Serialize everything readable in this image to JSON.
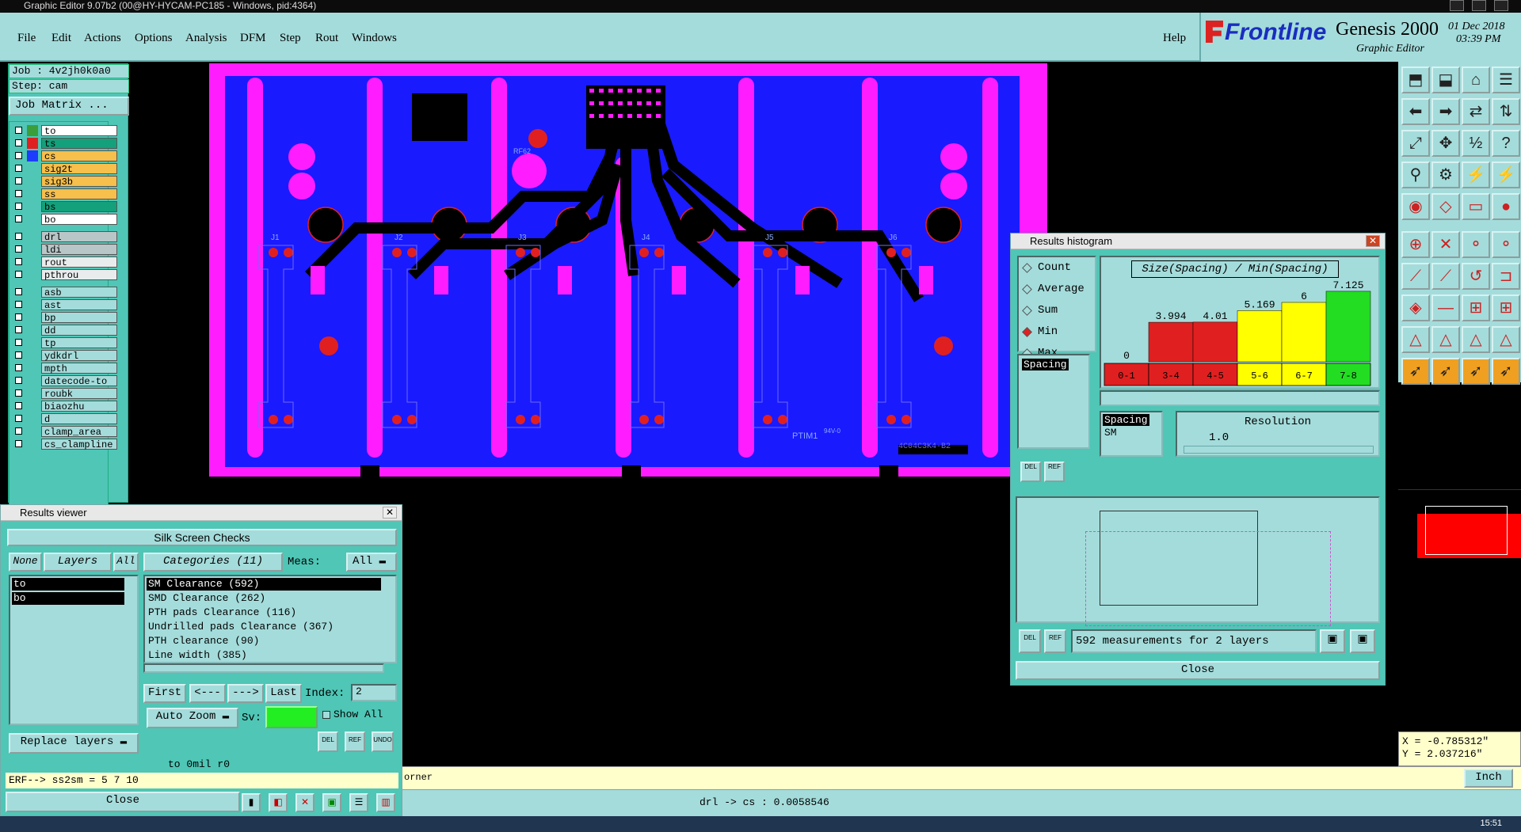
{
  "window": {
    "title": "Graphic Editor 9.07b2 (00@HY-HYCAM-PC185 - Windows, pid:4364)"
  },
  "menu": {
    "items": [
      "File",
      "Edit",
      "Actions",
      "Options",
      "Analysis",
      "DFM",
      "Step",
      "Rout",
      "Windows"
    ],
    "help": "Help"
  },
  "brand": {
    "logo": "Frontline",
    "product": "Genesis 2000",
    "subtitle": "Graphic Editor",
    "date": "01 Dec 2018",
    "time": "03:39 PM"
  },
  "job": {
    "job_label": "Job : 4v2jh0k0a0",
    "step_label": "Step: cam",
    "matrix_button": "Job Matrix ..."
  },
  "layers": [
    {
      "name": "to",
      "color": "#3a9f3a",
      "fill": "#ffffff"
    },
    {
      "name": "ts",
      "color": "#e02020",
      "fill": "#14a07a"
    },
    {
      "name": "cs",
      "color": "#1e3cff",
      "fill": "#f7bf4b"
    },
    {
      "name": "sig2t",
      "color": "",
      "fill": "#f7bf4b"
    },
    {
      "name": "sig3b",
      "color": "",
      "fill": "#f7bf4b"
    },
    {
      "name": "ss",
      "color": "",
      "fill": "#f7bf4b"
    },
    {
      "name": "bs",
      "color": "",
      "fill": "#14a07a"
    },
    {
      "name": "bo",
      "color": "",
      "fill": "#ffffff"
    },
    {
      "name": "drl",
      "color": "",
      "fill": "#b9c6c8"
    },
    {
      "name": "ldi",
      "color": "",
      "fill": "#b9c6c8"
    },
    {
      "name": "rout",
      "color": "",
      "fill": "#e9ecec"
    },
    {
      "name": "pthrou",
      "color": "",
      "fill": "#e9ecec"
    },
    {
      "name": "asb",
      "color": "",
      "fill": "#a4dcdb"
    },
    {
      "name": "ast",
      "color": "",
      "fill": "#a4dcdb"
    },
    {
      "name": "bp",
      "color": "",
      "fill": "#a4dcdb"
    },
    {
      "name": "dd",
      "color": "",
      "fill": "#a4dcdb"
    },
    {
      "name": "tp",
      "color": "",
      "fill": "#a4dcdb"
    },
    {
      "name": "ydkdrl",
      "color": "",
      "fill": "#a4dcdb"
    },
    {
      "name": "mpth",
      "color": "",
      "fill": "#a4dcdb"
    },
    {
      "name": "datecode-to",
      "color": "",
      "fill": "#a4dcdb"
    },
    {
      "name": "roubk",
      "color": "",
      "fill": "#a4dcdb"
    },
    {
      "name": "biaozhu",
      "color": "",
      "fill": "#a4dcdb"
    },
    {
      "name": "d",
      "color": "",
      "fill": "#a4dcdb"
    },
    {
      "name": "clamp_area",
      "color": "",
      "fill": "#a4dcdb"
    },
    {
      "name": "cs_clampline",
      "color": "",
      "fill": "#a4dcdb"
    }
  ],
  "pcb": {
    "connectors": [
      "J1",
      "J2",
      "J3",
      "J4",
      "J5",
      "J6"
    ],
    "label_rf": "RF62",
    "label_ptim": "PTIM1",
    "label_94v": "94V-0",
    "label_code": "4C04C3K4-B2"
  },
  "results_viewer": {
    "title": "Results viewer",
    "header": "Silk Screen Checks",
    "none_btn": "None",
    "layers_label": "Layers",
    "all_btn": "All",
    "layers": [
      "to",
      "bo"
    ],
    "categories_label": "Categories (11)",
    "meas_label": "Meas:",
    "meas_value": "All",
    "categories": [
      "SM Clearance (592)",
      "SMD Clearance (262)",
      "PTH pads Clearance (116)",
      "Undrilled pads Clearance (367)",
      "PTH clearance (90)",
      "Line width (385)"
    ],
    "first": "First",
    "prev": "<---",
    "next": "--->",
    "last": "Last",
    "index_label": "Index:",
    "index_value": "2",
    "autozoom": "Auto Zoom",
    "sv_label": "Sv:",
    "show_all": "Show All",
    "replace": "Replace layers",
    "layer_info": "to 0mil  r0",
    "erf": "ERF--> ss2sm = 5 7 10",
    "close": "Close",
    "del": "DEL",
    "ref": "REF",
    "undo": "UNDO"
  },
  "histogram": {
    "title": "Results histogram",
    "heading": "Size(Spacing) / Min(Spacing)",
    "options": [
      "Count",
      "Average",
      "Sum",
      "Min",
      "Max"
    ],
    "selected": "Min",
    "measure_list": [
      "Spacing"
    ],
    "res_list": [
      "Spacing",
      "SM"
    ],
    "resolution_label": "Resolution",
    "resolution_value": "1.0",
    "footer": "592 measurements for 2 layers",
    "close": "Close",
    "del": "DEL",
    "ref": "REF"
  },
  "chart_data": {
    "type": "bar",
    "title": "Size(Spacing) / Min(Spacing)",
    "categories": [
      "0-1",
      "3-4",
      "4-5",
      "5-6",
      "6-7",
      "7-8"
    ],
    "values": [
      0,
      3.994,
      4.01,
      5.169,
      6,
      7.125
    ],
    "value_labels": [
      "0",
      "3.994",
      "4.01",
      "5.169",
      "6",
      "7.125"
    ],
    "colors": [
      "#e02020",
      "#e02020",
      "#e02020",
      "#ffff00",
      "#ffff00",
      "#22dd22"
    ],
    "ylim": [
      0,
      8
    ],
    "grid": false
  },
  "coords": {
    "x": "X = -0.785312\"",
    "y": "Y = 2.037216\""
  },
  "units": "Inch",
  "bottom_text": "orner",
  "status": "drl -> cs : 0.0058546",
  "clock": "15:51"
}
